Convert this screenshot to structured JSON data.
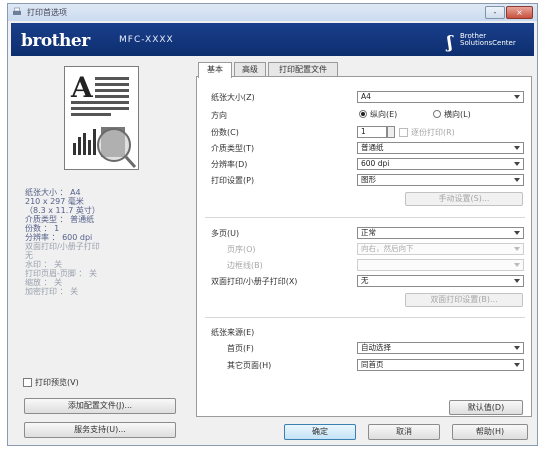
{
  "window": {
    "title": "打印首选项",
    "minimize": "-",
    "close": "×"
  },
  "banner": {
    "brand": "brother",
    "model": "MFC-XXXX",
    "solutions_line1": "Brother",
    "solutions_line2": "SolutionsCenter"
  },
  "summary": {
    "paper_size_label": "纸张大小 ： A4",
    "dims1": "210 x 297 毫米",
    "dims2": "（8.3 x 11.7 英寸）",
    "media_label": "介质类型 ： 普通纸",
    "copies": "份数 ： 1",
    "resolution": "分辨率 ： 600 dpi",
    "duplex": "双面打印/小册子打印",
    "duplex_val": "无",
    "watermark": "水印 ： 关",
    "header": "打印页眉-页脚 ： 关",
    "scaling": "缩放 ： 关",
    "security": "加密打印 ： 关"
  },
  "left_controls": {
    "preview_checkbox": "打印预览(V)",
    "add_profile": "添加配置文件(J)...",
    "support": "服务支持(U)..."
  },
  "tabs": [
    "基本",
    "高级",
    "打印配置文件"
  ],
  "basic": {
    "paper_size": {
      "label": "纸张大小(Z)",
      "value": "A4"
    },
    "orientation": {
      "label": "方向",
      "portrait": "纵向(E)",
      "landscape": "横向(L)"
    },
    "copies": {
      "label": "份数(C)",
      "value": "1",
      "collate": "逐份打印(R)"
    },
    "media_type": {
      "label": "介质类型(T)",
      "value": "普通纸"
    },
    "resolution": {
      "label": "分辨率(D)",
      "value": "600 dpi"
    },
    "print_settings": {
      "label": "打印设置(P)",
      "value": "图形",
      "manual_btn": "手动设置(S)..."
    },
    "multiple_page": {
      "label": "多页(U)",
      "value": "正常"
    },
    "page_order": {
      "label": "页序(O)",
      "value": "向右，然后向下"
    },
    "border_line": {
      "label": "边框线(B)",
      "value": ""
    },
    "duplex": {
      "label": "双面打印/小册子打印(X)",
      "value": "无",
      "settings_btn": "双面打印设置(B)..."
    },
    "paper_source": {
      "label": "纸张来源(E)",
      "first_page_label": "首页(F)",
      "first_page_value": "自动选择",
      "other_pages_label": "其它页面(H)",
      "other_pages_value": "同首页"
    },
    "default_btn": "默认值(D)"
  },
  "footer": {
    "ok": "确定",
    "cancel": "取消",
    "help": "帮助(H)"
  }
}
